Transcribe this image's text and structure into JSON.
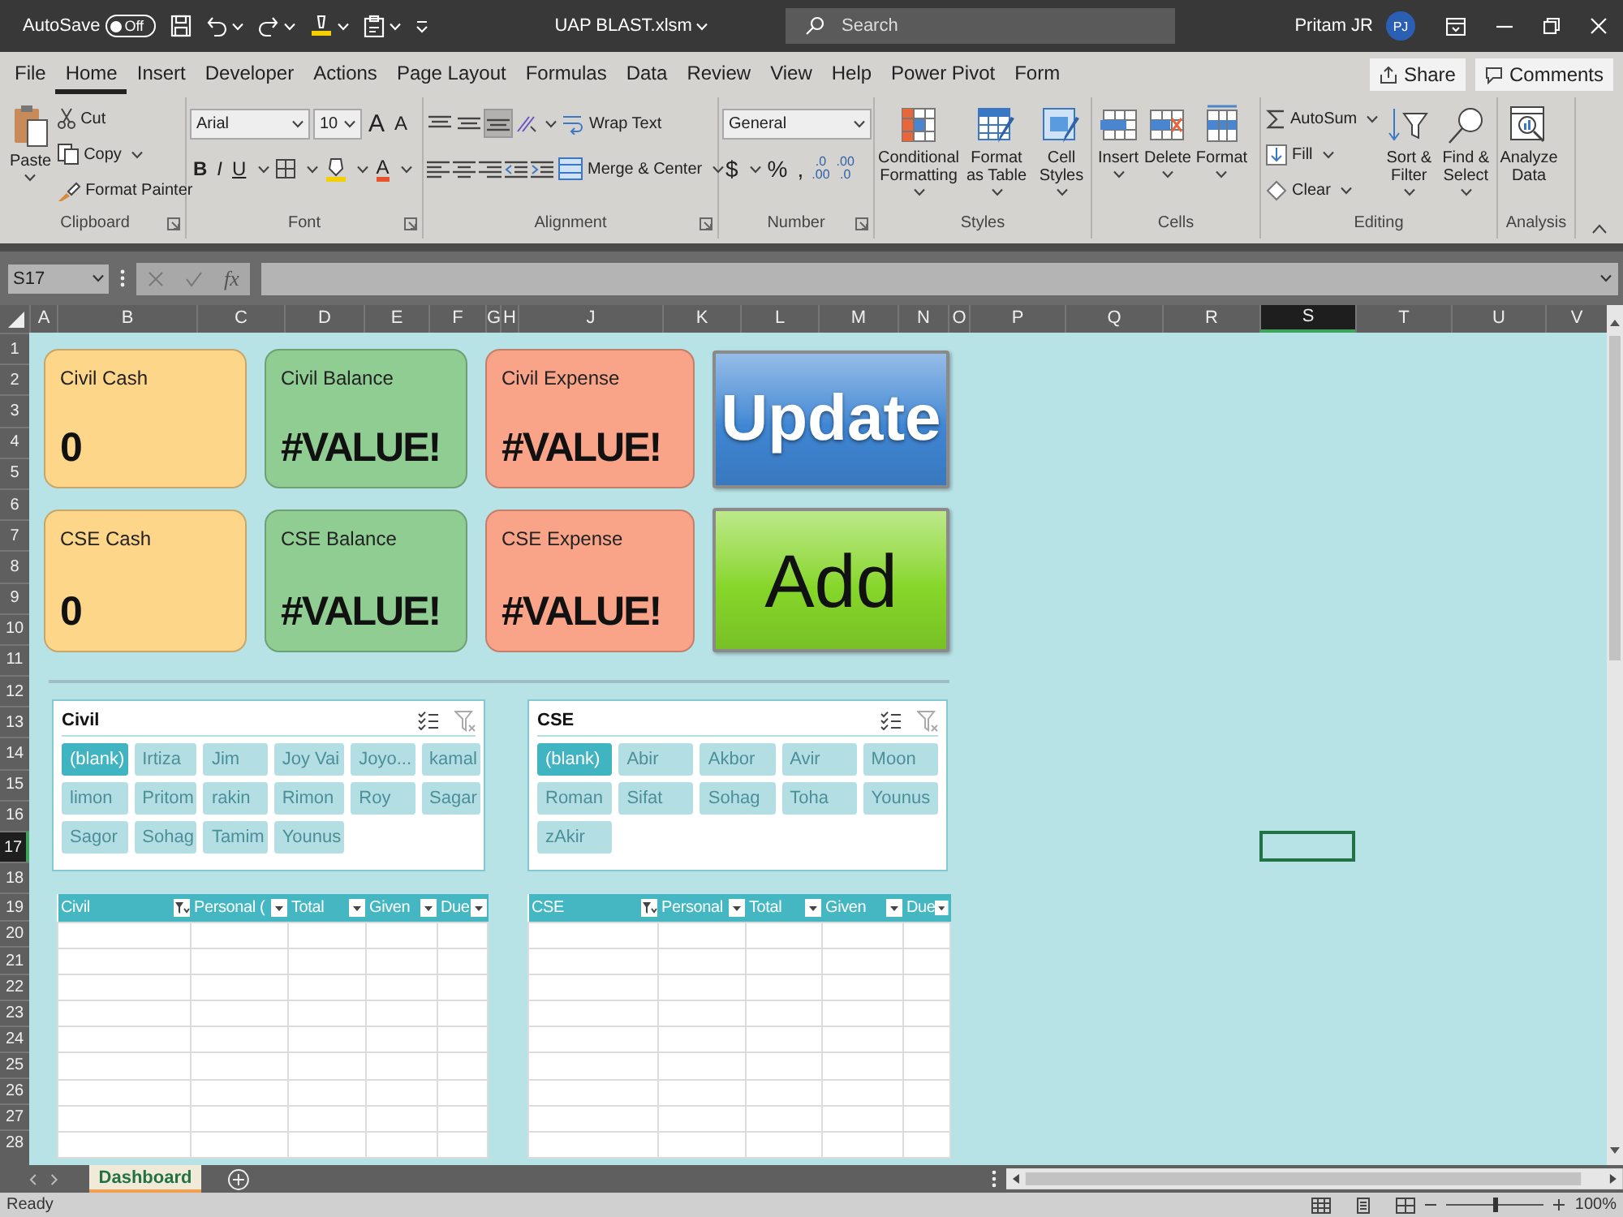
{
  "title_bar": {
    "autosave": {
      "label": "AutoSave",
      "state_text": "Off",
      "on": false
    },
    "file_name": "UAP BLAST.xlsm",
    "search": {
      "placeholder": "Search"
    },
    "user": {
      "name": "Pritam JR",
      "initials": "PJ"
    }
  },
  "menu_tabs": [
    {
      "label": "File",
      "selected": false
    },
    {
      "label": "Home",
      "selected": true
    },
    {
      "label": "Insert",
      "selected": false
    },
    {
      "label": "Developer",
      "selected": false
    },
    {
      "label": "Actions",
      "selected": false
    },
    {
      "label": "Page Layout",
      "selected": false
    },
    {
      "label": "Formulas",
      "selected": false
    },
    {
      "label": "Data",
      "selected": false
    },
    {
      "label": "Review",
      "selected": false
    },
    {
      "label": "View",
      "selected": false
    },
    {
      "label": "Help",
      "selected": false
    },
    {
      "label": "Power Pivot",
      "selected": false
    },
    {
      "label": "Form",
      "selected": false
    }
  ],
  "share_button": "Share",
  "comments_button": "Comments",
  "ribbon_groups": [
    {
      "kind": "clipboard",
      "name": "Clipboard",
      "buttons": [
        "Paste",
        "Cut",
        "Copy",
        "Format Painter"
      ]
    },
    {
      "kind": "font",
      "name": "Font",
      "font_name": "Arial",
      "font_size": "10",
      "size_buttons": [
        "A",
        "A"
      ],
      "style_buttons": [
        "B",
        "I",
        "U"
      ],
      "font_color": "A"
    },
    {
      "kind": "alignment",
      "name": "Alignment",
      "align_buttons": [
        {
          "selected": false
        },
        {
          "selected": false
        },
        {
          "selected": true
        }
      ],
      "buttons": [
        "Wrap Text",
        "Merge & Center"
      ]
    },
    {
      "kind": "number",
      "name": "Number",
      "format": "General",
      "symbols": [
        "$",
        "%",
        ","
      ],
      "decimal_buttons": [
        {
          "top": ".0",
          "bottom": ".00"
        },
        {
          "top": ".00",
          "bottom": ".0"
        }
      ]
    },
    {
      "kind": "styles",
      "name": "Styles",
      "buttons": [
        "Conditional Formatting",
        "Format as Table",
        "Cell Styles"
      ]
    },
    {
      "kind": "cells",
      "name": "Cells",
      "buttons": [
        "Insert",
        "Delete",
        "Format"
      ]
    },
    {
      "kind": "editing",
      "name": "Editing",
      "buttons": [
        "AutoSum",
        "Fill",
        "Clear",
        "Sort & Filter",
        "Find & Select"
      ]
    },
    {
      "kind": "analysis",
      "name": "Analysis",
      "buttons": [
        "Analyze Data"
      ]
    }
  ],
  "formula_bar": {
    "name_box": "S17",
    "function_label": "fx"
  },
  "columns": [
    {
      "label": "A",
      "selected": false
    },
    {
      "label": "B",
      "selected": false
    },
    {
      "label": "C",
      "selected": false
    },
    {
      "label": "D",
      "selected": false
    },
    {
      "label": "E",
      "selected": false
    },
    {
      "label": "F",
      "selected": false
    },
    {
      "label": "G",
      "selected": false
    },
    {
      "label": "H",
      "selected": false
    },
    {
      "label": "J",
      "selected": false
    },
    {
      "label": "K",
      "selected": false
    },
    {
      "label": "L",
      "selected": false
    },
    {
      "label": "M",
      "selected": false
    },
    {
      "label": "N",
      "selected": false
    },
    {
      "label": "O",
      "selected": false
    },
    {
      "label": "P",
      "selected": false
    },
    {
      "label": "Q",
      "selected": false
    },
    {
      "label": "R",
      "selected": false
    },
    {
      "label": "S",
      "selected": true
    },
    {
      "label": "T",
      "selected": false
    },
    {
      "label": "U",
      "selected": false
    },
    {
      "label": "V",
      "selected": false
    }
  ],
  "rows": [
    {
      "label": "1",
      "selected": false
    },
    {
      "label": "2",
      "selected": false
    },
    {
      "label": "3",
      "selected": false
    },
    {
      "label": "4",
      "selected": false
    },
    {
      "label": "5",
      "selected": false
    },
    {
      "label": "6",
      "selected": false
    },
    {
      "label": "7",
      "selected": false
    },
    {
      "label": "8",
      "selected": false
    },
    {
      "label": "9",
      "selected": false
    },
    {
      "label": "10",
      "selected": false
    },
    {
      "label": "11",
      "selected": false
    },
    {
      "label": "12",
      "selected": false
    },
    {
      "label": "13",
      "selected": false
    },
    {
      "label": "14",
      "selected": false
    },
    {
      "label": "15",
      "selected": false
    },
    {
      "label": "16",
      "selected": false
    },
    {
      "label": "17",
      "selected": true
    },
    {
      "label": "18",
      "selected": false
    },
    {
      "label": "19",
      "selected": false
    },
    {
      "label": "20",
      "selected": false
    },
    {
      "label": "21",
      "selected": false
    },
    {
      "label": "22",
      "selected": false
    },
    {
      "label": "23",
      "selected": false
    },
    {
      "label": "24",
      "selected": false
    },
    {
      "label": "25",
      "selected": false
    },
    {
      "label": "26",
      "selected": false
    },
    {
      "label": "27",
      "selected": false
    },
    {
      "label": "28",
      "selected": false
    }
  ],
  "cards": [
    {
      "label": "Civil Cash",
      "value": "0",
      "color": "#fed68a"
    },
    {
      "label": "Civil Balance",
      "value": "#VALUE!",
      "color": "#8fcd93"
    },
    {
      "label": "Civil Expense",
      "value": "#VALUE!",
      "color": "#f9a488"
    },
    {
      "label": "CSE Cash",
      "value": "0",
      "color": "#fed68a"
    },
    {
      "label": "CSE Balance",
      "value": "#VALUE!",
      "color": "#8fcd93"
    },
    {
      "label": "CSE Expense",
      "value": "#VALUE!",
      "color": "#f9a488"
    }
  ],
  "macro_buttons": [
    {
      "label": "Update",
      "color": "#3f86d4"
    },
    {
      "label": "Add",
      "color": "#86d62a"
    }
  ],
  "slicers": [
    {
      "title": "Civil",
      "items": [
        {
          "label": "(blank)",
          "selected": true
        },
        {
          "label": "Irtiza",
          "selected": false
        },
        {
          "label": "Jim",
          "selected": false
        },
        {
          "label": "Joy Vai",
          "selected": false
        },
        {
          "label": "Joyo...",
          "selected": false
        },
        {
          "label": "kamal",
          "selected": false
        },
        {
          "label": "limon",
          "selected": false
        },
        {
          "label": "Pritom",
          "selected": false
        },
        {
          "label": "rakin",
          "selected": false
        },
        {
          "label": "Rimon",
          "selected": false
        },
        {
          "label": "Roy",
          "selected": false
        },
        {
          "label": "Sagar",
          "selected": false
        },
        {
          "label": "Sagor",
          "selected": false
        },
        {
          "label": "Sohag",
          "selected": false
        },
        {
          "label": "Tamim",
          "selected": false
        },
        {
          "label": "Younus",
          "selected": false
        }
      ]
    },
    {
      "title": "CSE",
      "items": [
        {
          "label": "(blank)",
          "selected": true
        },
        {
          "label": "Abir",
          "selected": false
        },
        {
          "label": "Akbor",
          "selected": false
        },
        {
          "label": "Avir",
          "selected": false
        },
        {
          "label": "Moon",
          "selected": false
        },
        {
          "label": "Roman",
          "selected": false
        },
        {
          "label": "Sifat",
          "selected": false
        },
        {
          "label": "Sohag",
          "selected": false
        },
        {
          "label": "Toha",
          "selected": false
        },
        {
          "label": "Younus",
          "selected": false
        },
        {
          "label": "zAkir",
          "selected": false
        }
      ]
    }
  ],
  "tables": [
    {
      "columns": [
        {
          "label": "Civil",
          "filtered": true
        },
        {
          "label": "Personal (",
          "filtered": false
        },
        {
          "label": "Total",
          "filtered": false
        },
        {
          "label": "Given",
          "filtered": false
        },
        {
          "label": "Due",
          "filtered": false
        }
      ]
    },
    {
      "columns": [
        {
          "label": "CSE",
          "filtered": true
        },
        {
          "label": "Personal",
          "filtered": false
        },
        {
          "label": "Total",
          "filtered": false
        },
        {
          "label": "Given",
          "filtered": false
        },
        {
          "label": "Due",
          "filtered": false
        }
      ]
    }
  ],
  "sheet_tabs": [
    {
      "label": "Dashboard",
      "selected": true
    }
  ],
  "status_bar": {
    "text": "Ready",
    "zoom": {
      "level": 0.5,
      "reading": "100%"
    }
  }
}
